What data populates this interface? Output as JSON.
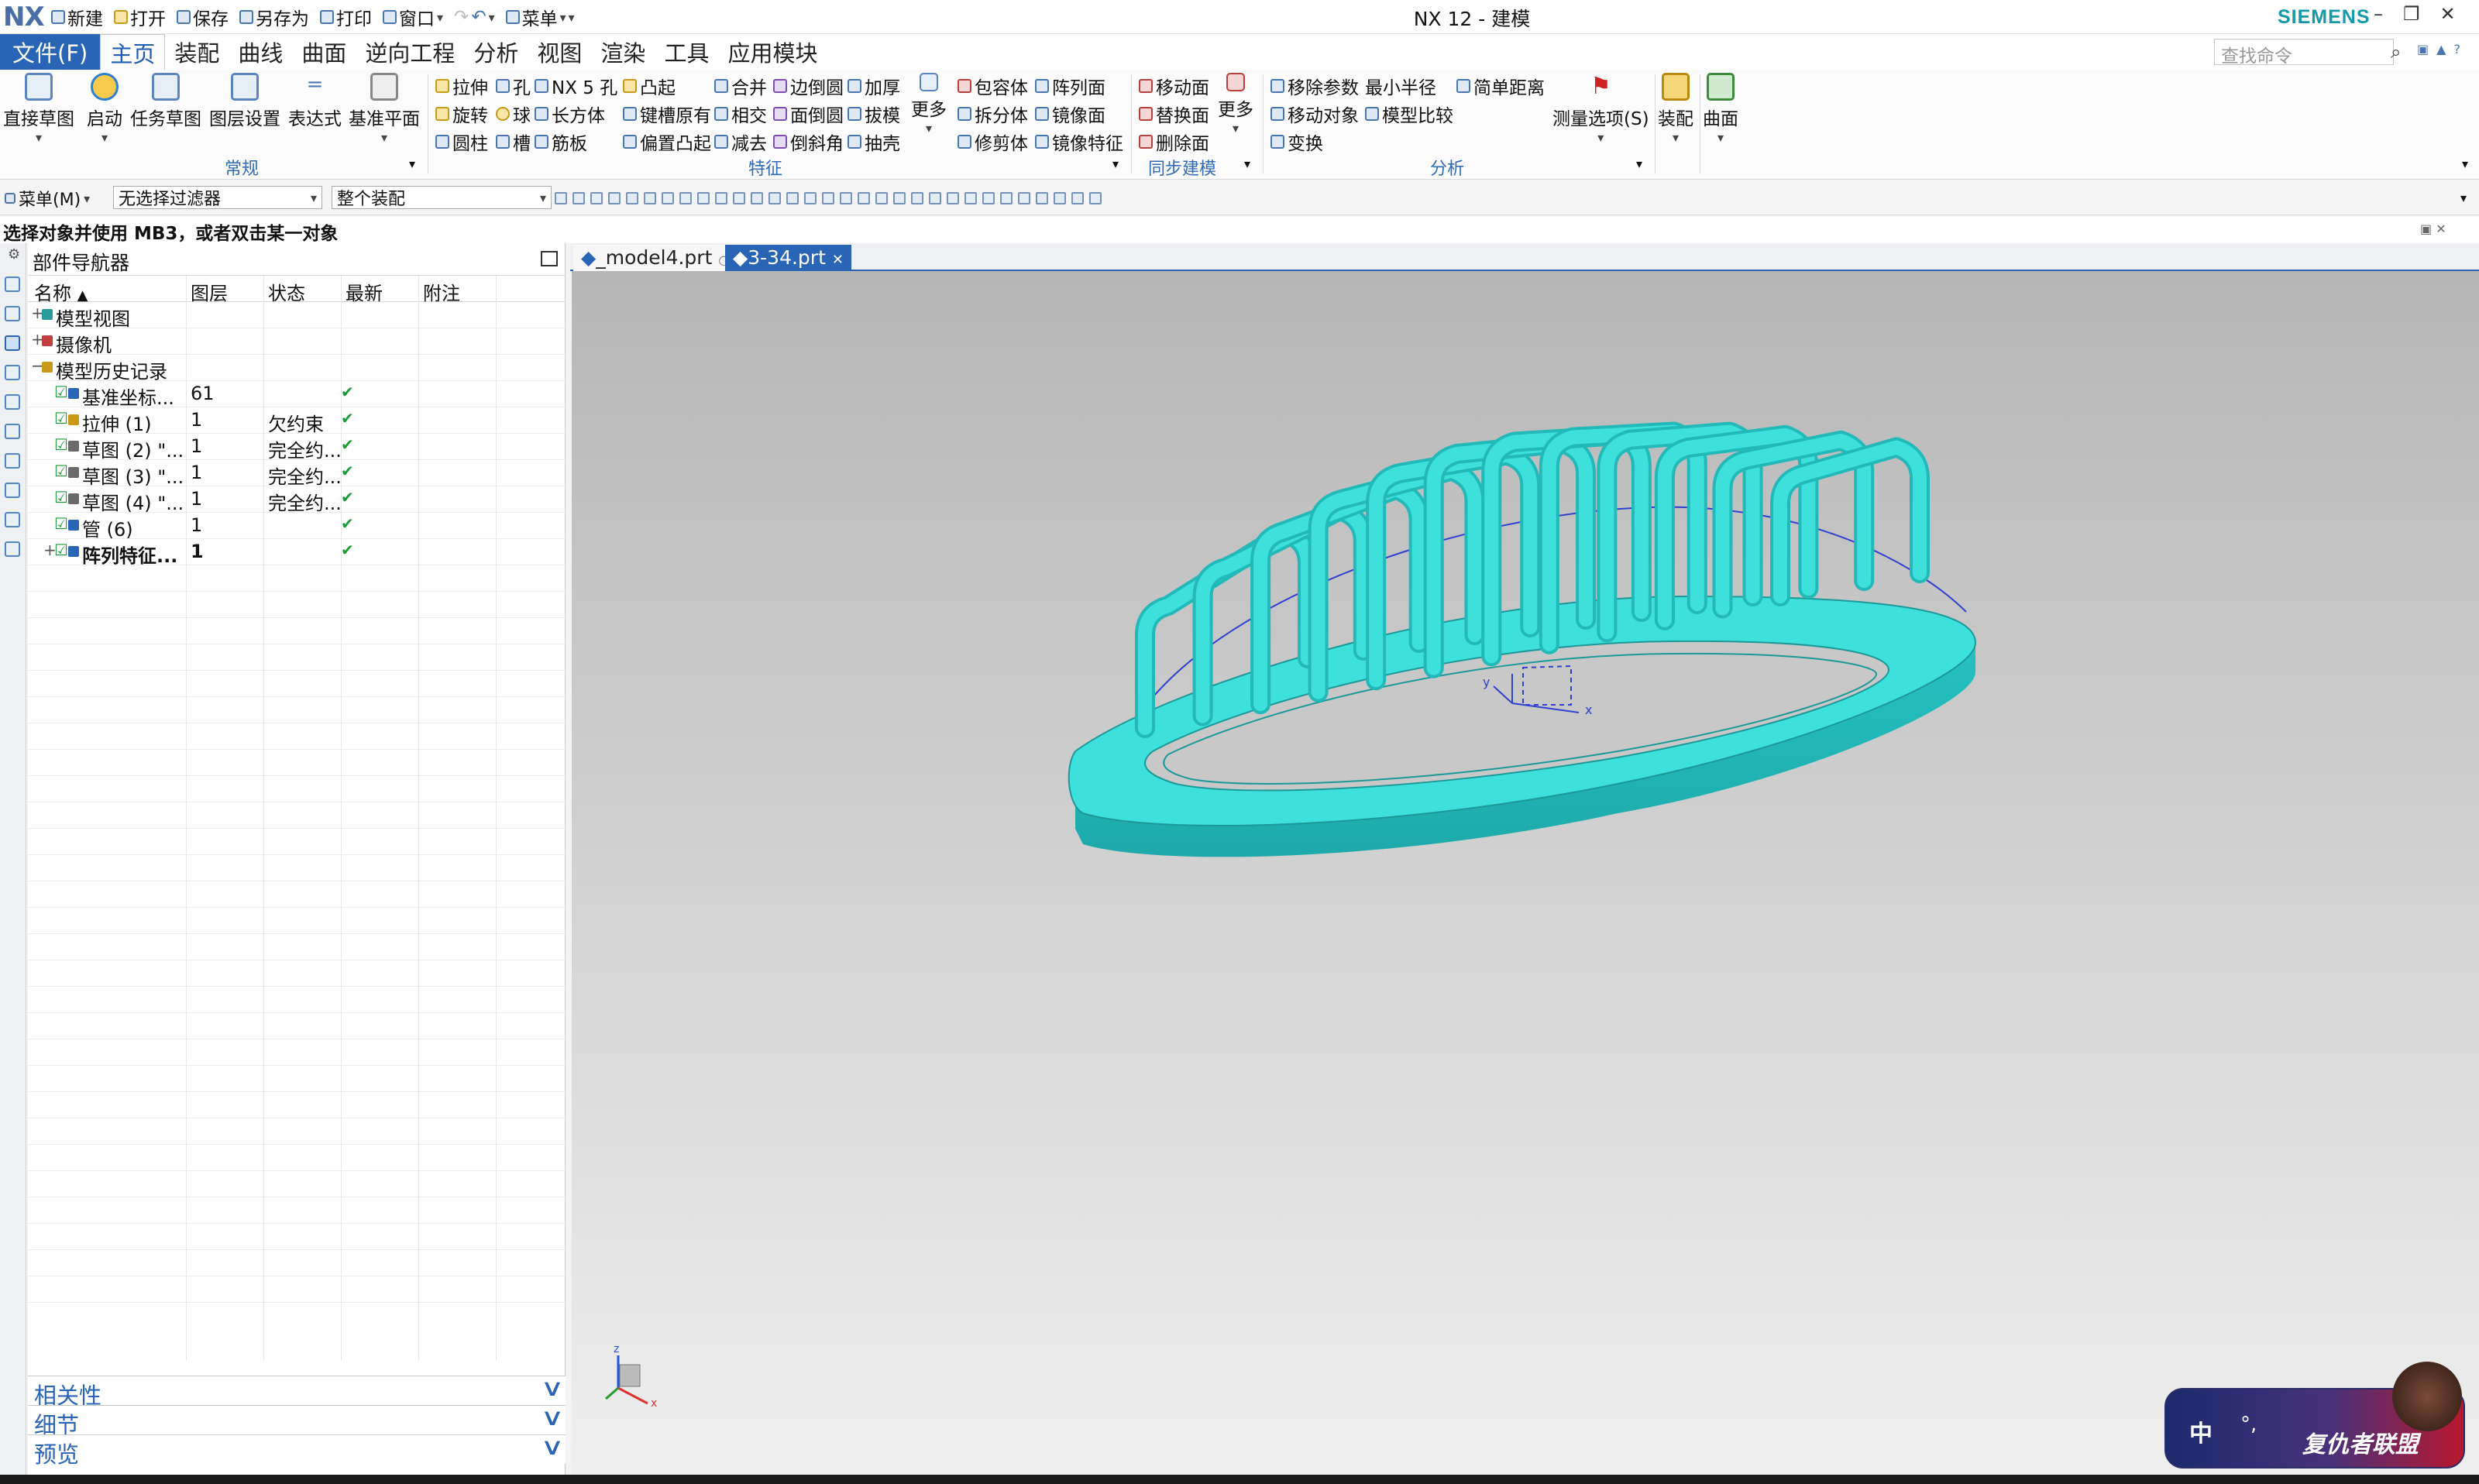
{
  "app": {
    "logo": "NX",
    "window_title": "NX 12 - 建模",
    "brand": "SIEMENS"
  },
  "quick_access": {
    "new": "新建",
    "open": "打开",
    "save": "保存",
    "save_as": "另存为",
    "print": "打印",
    "window": "窗口",
    "menu": "菜单"
  },
  "menubar": {
    "file": "文件(F)",
    "tabs": [
      "主页",
      "装配",
      "曲线",
      "曲面",
      "逆向工程",
      "分析",
      "视图",
      "渲染",
      "工具",
      "应用模块"
    ],
    "search_placeholder": "查找命令"
  },
  "ribbon": {
    "big_buttons": [
      "直接草图",
      "启动",
      "任务草图",
      "图层设置",
      "表达式",
      "基准平面"
    ],
    "group_general": "常规",
    "feature_cols": [
      [
        "拉伸",
        "旋转",
        "圆柱"
      ],
      [
        "孔",
        "球",
        "槽"
      ],
      [
        "NX 5 孔",
        "长方体",
        "筋板"
      ],
      [
        "凸起",
        "键槽原有",
        "偏置凸起"
      ],
      [
        "合并",
        "相交",
        "减去"
      ],
      [
        "边倒圆",
        "面倒圆",
        "倒斜角"
      ],
      [
        "加厚",
        "拔模",
        "抽壳"
      ]
    ],
    "more1": "更多",
    "feature_cols2": [
      [
        "包容体",
        "拆分体",
        "修剪体"
      ],
      [
        "阵列面",
        "镜像面",
        "镜像特征"
      ]
    ],
    "group_feature": "特征",
    "sync_col": [
      "移动面",
      "替换面",
      "删除面"
    ],
    "more2": "更多",
    "group_sync": "同步建模",
    "analysis_col": [
      "移除参数",
      "移动对象",
      "变换"
    ],
    "min_radius": "最小半径",
    "model_compare": "模型比较",
    "simple_distance": "简单距离",
    "measure_options": "测量选项(S)",
    "group_analysis": "分析",
    "assembly": "装配",
    "surface": "曲面"
  },
  "selection_bar": {
    "menu": "菜单(M)",
    "filter": "无选择过滤器",
    "scope": "整个装配"
  },
  "prompt": "选择对象并使用 MB3，或者双击某一对象",
  "navigator": {
    "title": "部件导航器",
    "columns": [
      "名称",
      "图层",
      "状态",
      "最新",
      "附注"
    ],
    "rows": [
      {
        "name": "模型视图",
        "layer": "",
        "status": "",
        "latest": ""
      },
      {
        "name": "摄像机",
        "layer": "",
        "status": "",
        "latest": ""
      },
      {
        "name": "模型历史记录",
        "layer": "",
        "status": "",
        "latest": ""
      },
      {
        "name": "基准坐标...",
        "layer": "61",
        "status": "",
        "latest": "✔"
      },
      {
        "name": "拉伸 (1)",
        "layer": "1",
        "status": "欠约束",
        "latest": "✔"
      },
      {
        "name": "草图 (2) \"...",
        "layer": "1",
        "status": "完全约...",
        "latest": "✔"
      },
      {
        "name": "草图 (3) \"...",
        "layer": "1",
        "status": "完全约...",
        "latest": "✔"
      },
      {
        "name": "草图 (4) \"...",
        "layer": "1",
        "status": "完全约...",
        "latest": "✔"
      },
      {
        "name": "管 (6)",
        "layer": "1",
        "status": "",
        "latest": "✔"
      },
      {
        "name": "阵列特征...",
        "layer": "1",
        "status": "",
        "latest": "✔"
      }
    ],
    "panels": [
      "相关性",
      "细节",
      "预览"
    ]
  },
  "graphics": {
    "tabs": [
      "_model4.prt",
      "3-34.prt"
    ],
    "triad": {
      "x": "x",
      "y": "y",
      "z": "z"
    },
    "colors": {
      "model": "#3ee0dc",
      "model_dark": "#22b9b8",
      "sketch": "#3040d0"
    }
  },
  "ime": {
    "lang": "中",
    "label": "复仇者联盟"
  }
}
